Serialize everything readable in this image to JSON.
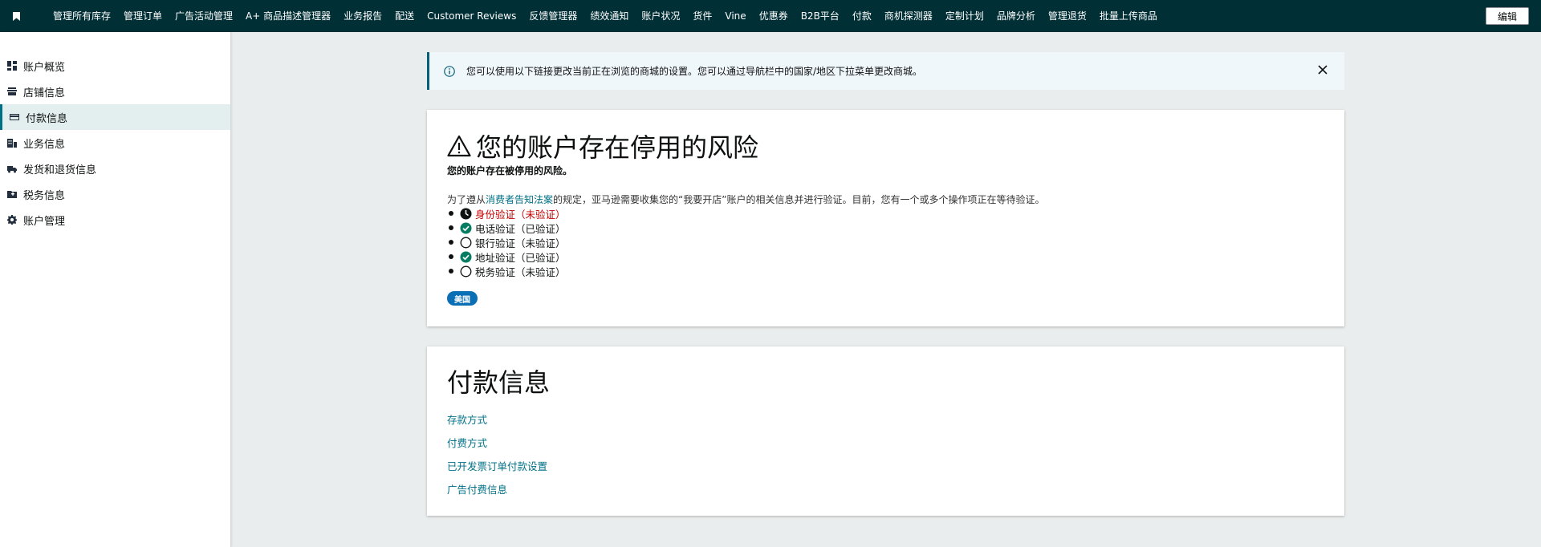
{
  "topnav": {
    "bookmark_icon": "bookmark-icon",
    "links": [
      "管理所有库存",
      "管理订单",
      "广告活动管理",
      "A+ 商品描述管理器",
      "业务报告",
      "配送",
      "Customer Reviews",
      "反馈管理器",
      "绩效通知",
      "账户状况",
      "货件",
      "Vine",
      "优惠券",
      "B2B平台",
      "付款",
      "商机探测器",
      "定制计划",
      "品牌分析",
      "管理退货",
      "批量上传商品"
    ],
    "edit_label": "编辑"
  },
  "sidebar": {
    "items": [
      {
        "label": "账户概览",
        "icon": "dashboard-icon"
      },
      {
        "label": "店铺信息",
        "icon": "store-icon"
      },
      {
        "label": "付款信息",
        "icon": "credit-card-icon"
      },
      {
        "label": "业务信息",
        "icon": "building-icon"
      },
      {
        "label": "发货和退货信息",
        "icon": "truck-icon"
      },
      {
        "label": "税务信息",
        "icon": "tax-folder-icon"
      },
      {
        "label": "账户管理",
        "icon": "gear-icon"
      }
    ],
    "active_index": 2
  },
  "banner": {
    "text": "您可以使用以下链接更改当前正在浏览的商城的设置。您可以通过导航栏中的国家/地区下拉菜单更改商城。",
    "icon": "info-icon"
  },
  "risk_card": {
    "title": "您的账户存在停用的风险",
    "subtitle": "您的账户存在被停用的风险。",
    "desc_prefix": "为了遵从",
    "desc_link": "消费者告知法案",
    "desc_suffix": "的规定，亚马逊需要收集您的“我要开店”账户的相关信息并进行验证。目前，您有一个或多个操作项正在等待验证。",
    "verifications": [
      {
        "label": "身份验证（未验证）",
        "status": "pending"
      },
      {
        "label": "电话验证（已验证）",
        "status": "verified"
      },
      {
        "label": "银行验证（未验证）",
        "status": "unverified"
      },
      {
        "label": "地址验证（已验证）",
        "status": "verified"
      },
      {
        "label": "税务验证（未验证）",
        "status": "unverified"
      }
    ],
    "country_badge": "美国"
  },
  "payment_card": {
    "title": "付款信息",
    "links": [
      "存款方式",
      "付费方式",
      "已开发票订单付款设置",
      "广告付费信息"
    ]
  },
  "colors": {
    "nav_bg": "#002f36",
    "link": "#007185",
    "verified_green": "#067d62",
    "pending_red": "#c40000",
    "badge_blue": "#0a6fb5"
  }
}
